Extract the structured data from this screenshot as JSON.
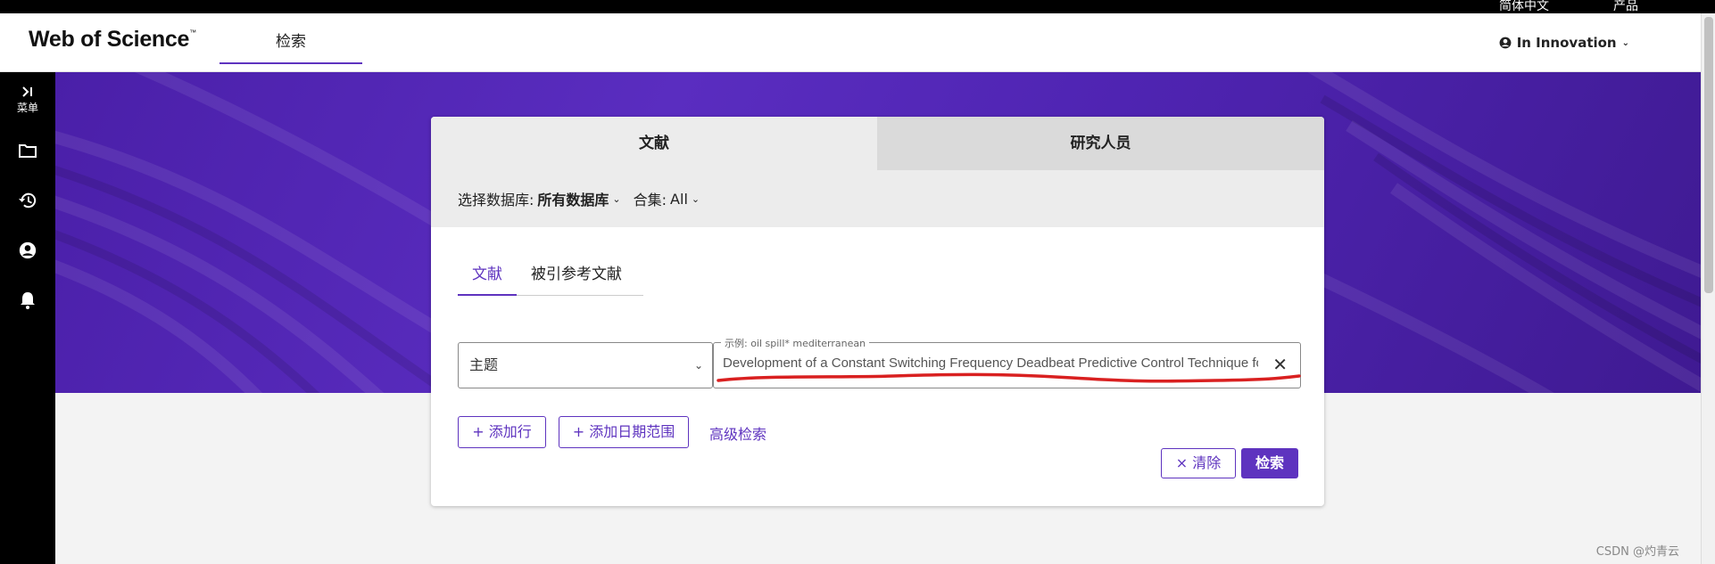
{
  "topbar": {
    "left_text": "简体中文",
    "right_text": "产品"
  },
  "header": {
    "logo": "Web of Science",
    "logo_tm": "™",
    "nav_tab": "检索",
    "user_menu": "In Innovation"
  },
  "sidebar": {
    "menu_label": "菜单",
    "items": [
      "expand-icon",
      "folder-icon",
      "history-icon",
      "account-icon",
      "bell-icon"
    ]
  },
  "search_card": {
    "tabs": [
      "文献",
      "研究人员"
    ],
    "database_label": "选择数据库:",
    "database_value": "所有数据库",
    "collection_label": "合集:",
    "collection_value": "All",
    "sub_tabs": [
      "文献",
      "被引参考文献"
    ],
    "field_value": "主题",
    "query_legend": "示例: oil spill* mediterranean",
    "query_value": "Development of a Constant Switching Frequency Deadbeat Predictive Control Technique fo",
    "add_row": "添加行",
    "add_date_range": "添加日期范围",
    "advanced_search": "高级检索",
    "clear": "清除",
    "search": "检索"
  },
  "watermark": "CSDN @灼青云",
  "colors": {
    "accent": "#5e33bf",
    "banner": "#5a2dc0",
    "annotation": "#d92020"
  }
}
